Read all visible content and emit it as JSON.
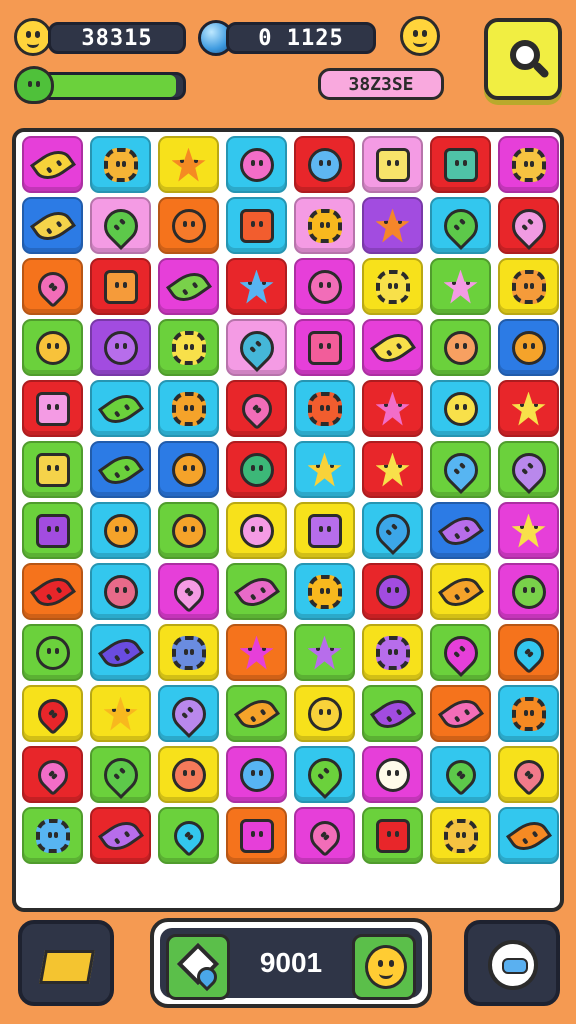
{
  "hud": {
    "coins_value": "38315",
    "gems_value": "0 1125",
    "bonus_badge": "38Z3SE",
    "progress": 0.95
  },
  "score": {
    "value": "9001"
  },
  "colors": {
    "background": "#F59A52",
    "magenta": "#E63FD9",
    "cyan": "#33C7EE",
    "yellow": "#F7E11B",
    "red": "#E8262A",
    "green": "#6BD13C",
    "orange": "#F5731C",
    "blue": "#2C7BE5",
    "purple": "#A24CE0",
    "pink": "#F49BE4"
  },
  "board": {
    "rows": [
      [
        [
          "magenta",
          "leaf",
          "#F6D23A"
        ],
        [
          "cyan",
          "gear",
          "#F5B436"
        ],
        [
          "yellow",
          "star",
          "#F58A23"
        ],
        [
          "cyan",
          "circle",
          "#F26DC8"
        ],
        [
          "red",
          "circle",
          "#5EB7F2"
        ],
        [
          "pink",
          "square",
          "#F7E36A"
        ],
        [
          "red",
          "square",
          "#4FC3A7"
        ],
        [
          "magenta",
          "gear",
          "#F5C341"
        ]
      ],
      [
        [
          "blue",
          "leaf",
          "#F5D34A"
        ],
        [
          "pink",
          "drop",
          "#5DC94A"
        ],
        [
          "orange",
          "circle",
          "#F57A2A"
        ],
        [
          "cyan",
          "square",
          "#F25D2E"
        ],
        [
          "pink",
          "gear",
          "#F8B81E"
        ],
        [
          "purple",
          "star",
          "#F5862A"
        ],
        [
          "cyan",
          "drop",
          "#5DC94A"
        ],
        [
          "red",
          "drop",
          "#F19BE2"
        ]
      ],
      [
        [
          "orange",
          "heart",
          "#F26DB8"
        ],
        [
          "red",
          "square",
          "#F59B3A"
        ],
        [
          "magenta",
          "leaf",
          "#79D14A"
        ],
        [
          "red",
          "star",
          "#57B5F2"
        ],
        [
          "magenta",
          "circle",
          "#F26DB8"
        ],
        [
          "yellow",
          "gear",
          "#F8E04A"
        ],
        [
          "green",
          "star",
          "#F49BE4"
        ],
        [
          "yellow",
          "gear",
          "#F59B3A"
        ]
      ],
      [
        [
          "green",
          "circle",
          "#F8C23A"
        ],
        [
          "purple",
          "circle",
          "#B76DEB"
        ],
        [
          "green",
          "gear",
          "#F8E04A"
        ],
        [
          "pink",
          "drop",
          "#45B7D8"
        ],
        [
          "magenta",
          "square",
          "#F25D9A"
        ],
        [
          "magenta",
          "leaf",
          "#F8E04A"
        ],
        [
          "green",
          "circle",
          "#F7A061"
        ],
        [
          "blue",
          "circle",
          "#F5A32A"
        ]
      ],
      [
        [
          "red",
          "square",
          "#F49BE4"
        ],
        [
          "cyan",
          "leaf",
          "#6BD13C"
        ],
        [
          "cyan",
          "gear",
          "#F5A32A"
        ],
        [
          "red",
          "heart",
          "#F26DB8"
        ],
        [
          "cyan",
          "gear",
          "#F25D2E"
        ],
        [
          "red",
          "star",
          "#F26DC8"
        ],
        [
          "cyan",
          "circle",
          "#F8E04A"
        ],
        [
          "red",
          "star",
          "#F8E04A"
        ]
      ],
      [
        [
          "green",
          "square",
          "#F5D34A"
        ],
        [
          "blue",
          "leaf",
          "#6BD13C"
        ],
        [
          "blue",
          "circle",
          "#F5A32A"
        ],
        [
          "red",
          "circle",
          "#3CB878"
        ],
        [
          "cyan",
          "star",
          "#F8D23A"
        ],
        [
          "red",
          "star",
          "#F8E04A"
        ],
        [
          "green",
          "drop",
          "#57B5F2"
        ],
        [
          "green",
          "drop",
          "#B988EC"
        ]
      ],
      [
        [
          "green",
          "square",
          "#A24CE0"
        ],
        [
          "cyan",
          "circle",
          "#F5A32A"
        ],
        [
          "green",
          "circle",
          "#F5A32A"
        ],
        [
          "yellow",
          "circle",
          "#F49BE4"
        ],
        [
          "yellow",
          "square",
          "#B76DEB"
        ],
        [
          "cyan",
          "drop",
          "#3CA6E8"
        ],
        [
          "blue",
          "leaf",
          "#B76DEB"
        ],
        [
          "magenta",
          "star",
          "#F8E04A"
        ]
      ],
      [
        [
          "orange",
          "leaf",
          "#E8262A"
        ],
        [
          "cyan",
          "circle",
          "#E86A8A"
        ],
        [
          "magenta",
          "heart",
          "#F49BE4"
        ],
        [
          "green",
          "leaf",
          "#E86AC8"
        ],
        [
          "cyan",
          "gear",
          "#F8B81E"
        ],
        [
          "red",
          "circle",
          "#A24CE0"
        ],
        [
          "yellow",
          "leaf",
          "#F5A32A"
        ],
        [
          "magenta",
          "circle",
          "#79D14A"
        ]
      ],
      [
        [
          "green",
          "circle",
          "#6BD13C"
        ],
        [
          "cyan",
          "leaf",
          "#6A4CE0"
        ],
        [
          "yellow",
          "gear",
          "#6A8CE0"
        ],
        [
          "orange",
          "star",
          "#E63FD9"
        ],
        [
          "green",
          "star",
          "#B76DEB"
        ],
        [
          "yellow",
          "gear",
          "#B76DEB"
        ],
        [
          "green",
          "drop",
          "#E63FD9"
        ],
        [
          "orange",
          "heart",
          "#33C7EE"
        ]
      ],
      [
        [
          "yellow",
          "heart",
          "#E8262A"
        ],
        [
          "yellow",
          "star",
          "#F8B81E"
        ],
        [
          "cyan",
          "drop",
          "#B988EC"
        ],
        [
          "green",
          "leaf",
          "#F5A32A"
        ],
        [
          "yellow",
          "circle",
          "#F8D23A"
        ],
        [
          "green",
          "leaf",
          "#A24CE0"
        ],
        [
          "orange",
          "leaf",
          "#F26DB8"
        ],
        [
          "cyan",
          "gear",
          "#F58A23"
        ]
      ],
      [
        [
          "red",
          "heart",
          "#F26DC8"
        ],
        [
          "green",
          "drop",
          "#5DC94A"
        ],
        [
          "yellow",
          "circle",
          "#F57A5A"
        ],
        [
          "magenta",
          "circle",
          "#57B5F2"
        ],
        [
          "cyan",
          "drop",
          "#6BD13C"
        ],
        [
          "magenta",
          "circle",
          "#FFFBEA"
        ],
        [
          "cyan",
          "heart",
          "#5DC94A"
        ],
        [
          "yellow",
          "heart",
          "#F27A8A"
        ]
      ],
      [
        [
          "green",
          "gear",
          "#57B5F2"
        ],
        [
          "red",
          "leaf",
          "#B76DEB"
        ],
        [
          "green",
          "heart",
          "#33C7EE"
        ],
        [
          "orange",
          "square",
          "#E63FD9"
        ],
        [
          "magenta",
          "heart",
          "#F26DB8"
        ],
        [
          "green",
          "square",
          "#E8262A"
        ],
        [
          "yellow",
          "gear",
          "#F5C341"
        ],
        [
          "cyan",
          "leaf",
          "#F58A23"
        ]
      ]
    ]
  }
}
